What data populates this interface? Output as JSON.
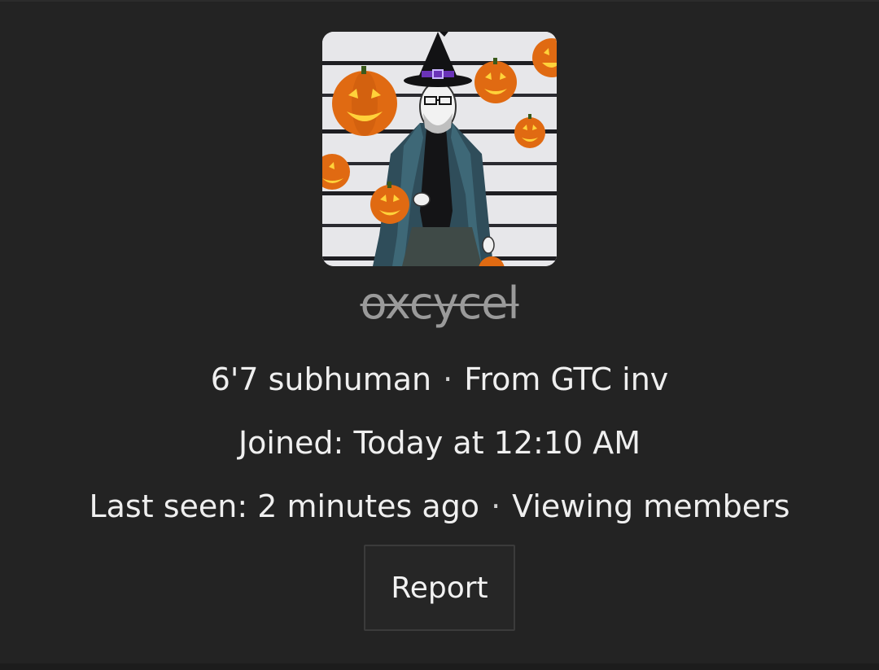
{
  "profile": {
    "username": "oxcycel",
    "bio": "6'7 subhuman",
    "source": "From GTC inv",
    "joined_label": "Joined:",
    "joined_value": "Today at 12:10 AM",
    "last_seen_label": "Last seen:",
    "last_seen_value": "2 minutes ago",
    "activity": "Viewing members",
    "separator": "·",
    "avatar_icon": "witch-hat-wojak-with-pumpkins-avatar"
  },
  "actions": {
    "report_label": "Report"
  },
  "colors": {
    "background": "#232323",
    "text": "#efefef",
    "username_muted": "#9a9a9a",
    "button_bg": "#262626",
    "button_border": "#3b3b3b"
  }
}
